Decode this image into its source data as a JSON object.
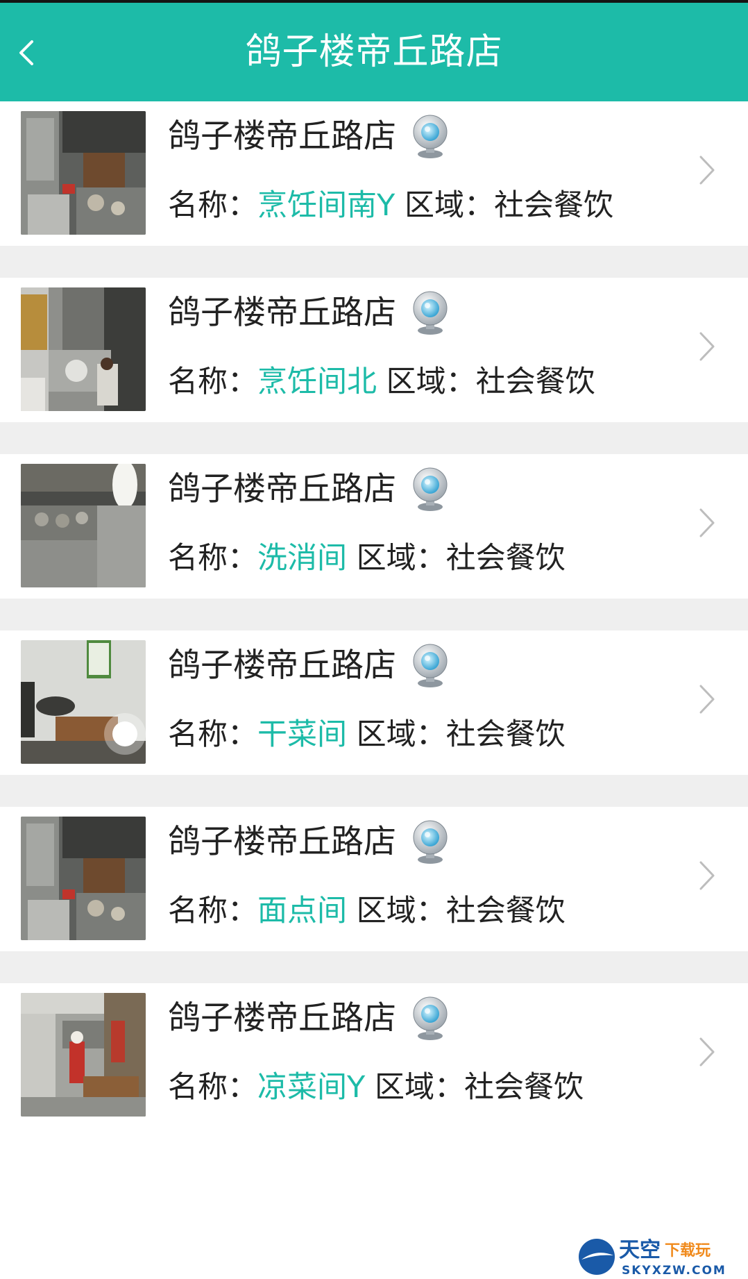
{
  "header": {
    "title": "鸽子楼帝丘路店",
    "back_icon": "chevron-left-icon",
    "background": "#1dbba8"
  },
  "labels": {
    "name_prefix": "名称：",
    "region_prefix": "区域："
  },
  "colors": {
    "accent": "#1dbba8",
    "divider": "#efefef"
  },
  "cameras": [
    {
      "store": "鸽子楼帝丘路店",
      "name": "烹饪间南Y",
      "region": "社会餐饮",
      "icon": "webcam-icon"
    },
    {
      "store": "鸽子楼帝丘路店",
      "name": "烹饪间北",
      "region": "社会餐饮",
      "icon": "webcam-icon"
    },
    {
      "store": "鸽子楼帝丘路店",
      "name": "洗消间",
      "region": "社会餐饮",
      "icon": "webcam-icon"
    },
    {
      "store": "鸽子楼帝丘路店",
      "name": "干菜间",
      "region": "社会餐饮",
      "icon": "webcam-icon"
    },
    {
      "store": "鸽子楼帝丘路店",
      "name": "面点间",
      "region": "社会餐饮",
      "icon": "webcam-icon"
    },
    {
      "store": "鸽子楼帝丘路店",
      "name": "凉菜间Y",
      "region": "社会餐饮",
      "icon": "webcam-icon"
    }
  ],
  "watermark": {
    "brand": "天空",
    "sub": "下载玩",
    "domain": "SKYXZW.COM"
  }
}
